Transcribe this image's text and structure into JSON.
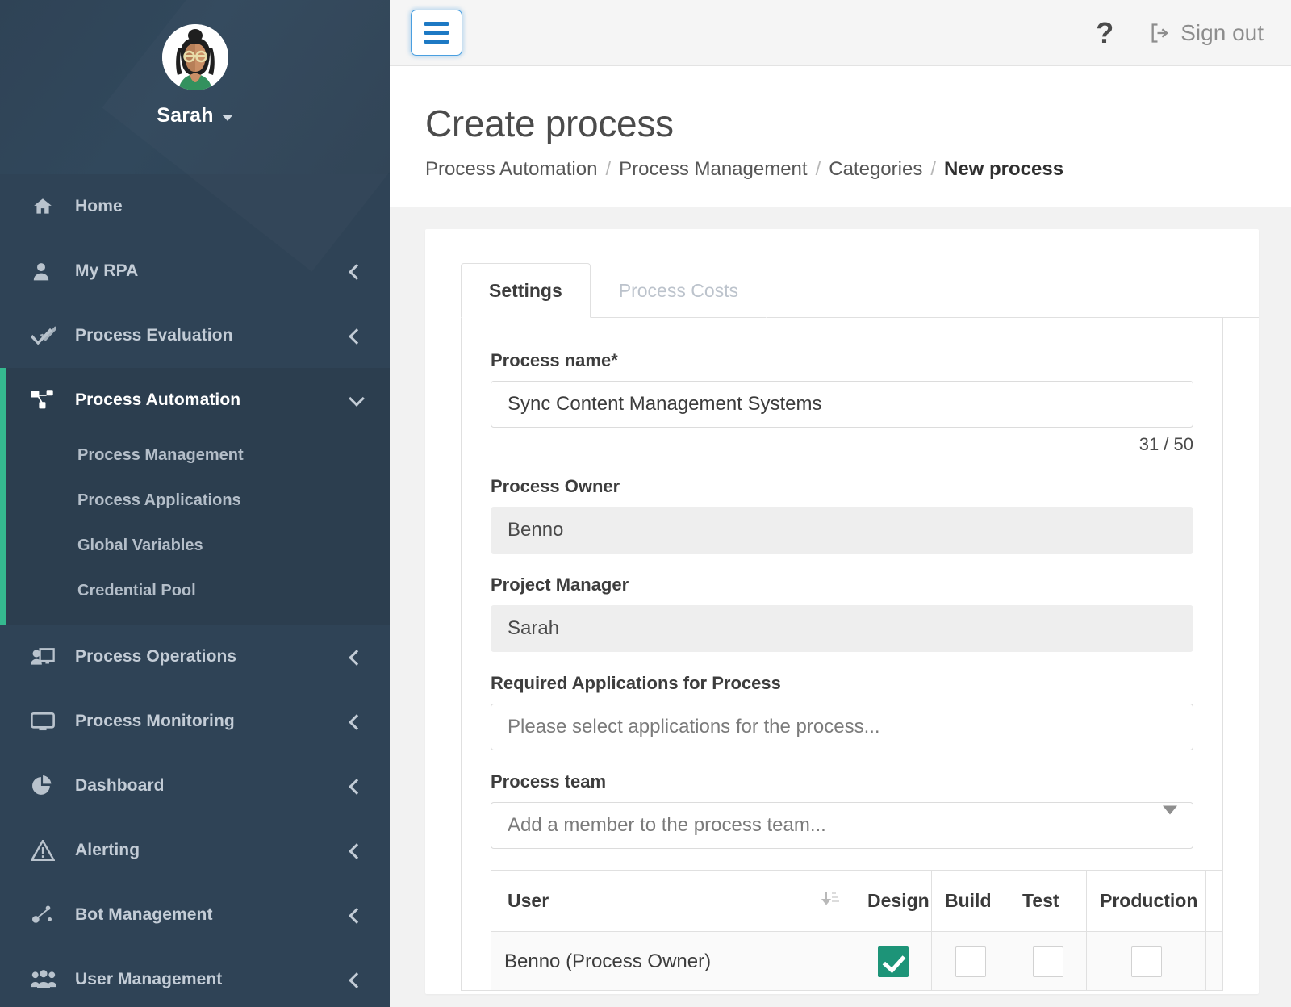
{
  "sidebar": {
    "user": {
      "name": "Sarah",
      "avatar_icon": "user-avatar"
    },
    "items": [
      {
        "label": "Home",
        "icon": "home-icon",
        "expandable": false
      },
      {
        "label": "My RPA",
        "icon": "person-icon",
        "expandable": true
      },
      {
        "label": "Process Evaluation",
        "icon": "double-check-icon",
        "expandable": true
      },
      {
        "label": "Process Automation",
        "icon": "sitemap-icon",
        "expandable": true,
        "active": true
      },
      {
        "label": "Process Operations",
        "icon": "presentation-person-icon",
        "expandable": true
      },
      {
        "label": "Process Monitoring",
        "icon": "monitor-icon",
        "expandable": true
      },
      {
        "label": "Dashboard",
        "icon": "pie-chart-icon",
        "expandable": true
      },
      {
        "label": "Alerting",
        "icon": "warning-triangle-icon",
        "expandable": true
      },
      {
        "label": "Bot Management",
        "icon": "bot-network-icon",
        "expandable": true
      },
      {
        "label": "User Management",
        "icon": "users-icon",
        "expandable": true
      }
    ],
    "subitems": [
      {
        "label": "Process Management"
      },
      {
        "label": "Process Applications"
      },
      {
        "label": "Global Variables"
      },
      {
        "label": "Credential Pool"
      }
    ],
    "accent_color": "#35b98f",
    "background_color": "#2f4356",
    "active_background_color": "#2c3e4f"
  },
  "topbar": {
    "menu_toggle_icon": "hamburger-icon",
    "help_label": "?",
    "signout_label": "Sign out",
    "signout_icon": "sign-out-icon"
  },
  "page": {
    "title": "Create process",
    "breadcrumb": [
      {
        "label": "Process Automation",
        "current": false
      },
      {
        "label": "Process Management",
        "current": false
      },
      {
        "label": "Categories",
        "current": false
      },
      {
        "label": "New process",
        "current": true
      }
    ],
    "breadcrumb_separator": "/"
  },
  "tabs": [
    {
      "label": "Settings",
      "active": true
    },
    {
      "label": "Process Costs",
      "active": false
    }
  ],
  "form": {
    "process_name": {
      "label": "Process name*",
      "value": "Sync Content Management Systems",
      "counter": "31 / 50"
    },
    "process_owner": {
      "label": "Process Owner",
      "value": "Benno"
    },
    "project_manager": {
      "label": "Project Manager",
      "value": "Sarah"
    },
    "required_applications": {
      "label": "Required Applications for Process",
      "placeholder": "Please select applications for the process..."
    },
    "process_team": {
      "label": "Process team",
      "placeholder": "Add a member to the process team...",
      "dropdown_icon": "chevron-down-icon"
    }
  },
  "team_table": {
    "columns": [
      "User",
      "Design",
      "Build",
      "Test",
      "Production",
      ""
    ],
    "sort_icon": "sort-descending-icon",
    "rows": [
      {
        "user": "Benno (Process Owner)",
        "design": true,
        "build": false,
        "test": false,
        "production": false,
        "delete_icon": "trash-icon"
      }
    ]
  },
  "colors": {
    "accent_green": "#35b98f",
    "checkbox_checked": "#1d9478",
    "primary_blue": "#1d79c4",
    "sidebar_bg": "#2f4356"
  }
}
